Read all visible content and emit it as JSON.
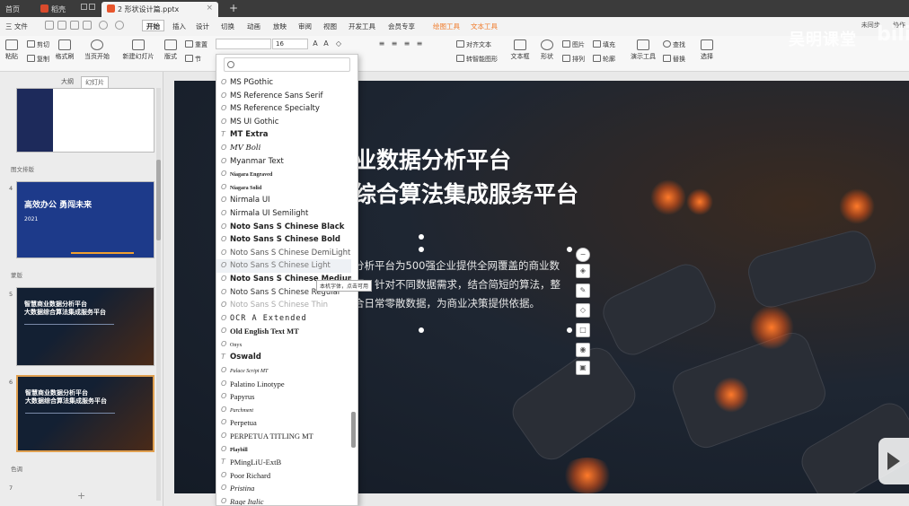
{
  "tabs": {
    "home": "首页",
    "docer": "稻壳",
    "file": "2 形状设计篇.pptx",
    "new_tab": "+"
  },
  "menubar": {
    "file": "三 文件",
    "items": [
      "开始",
      "插入",
      "设计",
      "切换",
      "动画",
      "放映",
      "审阅",
      "视图",
      "开发工具",
      "会员专享"
    ],
    "contextual": [
      "绘图工具",
      "文本工具"
    ],
    "user": [
      "未同步",
      "协作"
    ]
  },
  "ribbon": {
    "paste": "粘贴",
    "cut": "剪切",
    "copy": "复制",
    "format_painter": "格式刷",
    "from_current": "当页开始",
    "new_slide": "新建幻灯片",
    "layout": "版式",
    "section": "节",
    "reset": "重置",
    "font_size": "16",
    "align_text": "对齐文本",
    "convert_smartart": "转智能图形",
    "textbox": "文本框",
    "shape": "形状",
    "arrange": "排列",
    "picture": "图片",
    "fill": "填充",
    "outline": "轮廓",
    "presenter_tools": "演示工具",
    "find": "查找",
    "replace": "替换",
    "select": "选择"
  },
  "left_panel": {
    "tab_outline": "大纲",
    "tab_slides": "幻灯片",
    "section1": "图文排版",
    "section2": "蒙版",
    "section3": "色调",
    "slide_numbers": [
      "4",
      "5",
      "6",
      "7"
    ],
    "thumb4_title": "高效办公 勇闯未来",
    "thumb4_year": "2021",
    "thumb5_title": "智慧商业数据分析平台\n大数据综合算法集成服务平台",
    "thumb6_title": "智慧商业数据分析平台\n大数据综合算法集成服务平台",
    "add": "+"
  },
  "slide": {
    "title_line1": "业数据分析平台",
    "title_line2": "综合算法集成服务平台",
    "body": "分析平台为500强企业提供全网覆盖的商业数据，针对不同数据需求，结合简短的算法，整合日常零散数据，为商业决策提供依据。"
  },
  "font_dropdown": {
    "search_placeholder": "",
    "tooltip": "本机字体，点击可用",
    "fonts": [
      "MS PGothic",
      "MS Reference Sans Serif",
      "MS Reference Specialty",
      "MS UI Gothic",
      "MT Extra",
      "MV Boli",
      "Myanmar Text",
      "Niagara Engraved",
      "Niagara Solid",
      "Nirmala UI",
      "Nirmala UI Semilight",
      "Noto Sans S Chinese Black",
      "Noto Sans S Chinese Bold",
      "Noto Sans S Chinese DemiLight",
      "Noto Sans S Chinese Light",
      "Noto Sans S Chinese Medium",
      "Noto Sans S Chinese Regular",
      "Noto Sans S Chinese Thin",
      "OCR A Extended",
      "Old English Text MT",
      "Onyx",
      "Oswald",
      "Palace Script MT",
      "Palatino Linotype",
      "Papyrus",
      "Parchment",
      "Perpetua",
      "PERPETUA TITLING MT",
      "Playbill",
      "PMingLiU-ExtB",
      "Poor Richard",
      "Pristina",
      "Rage Italic"
    ]
  },
  "watermark": {
    "text": "吴明课堂",
    "brand": "bili"
  }
}
